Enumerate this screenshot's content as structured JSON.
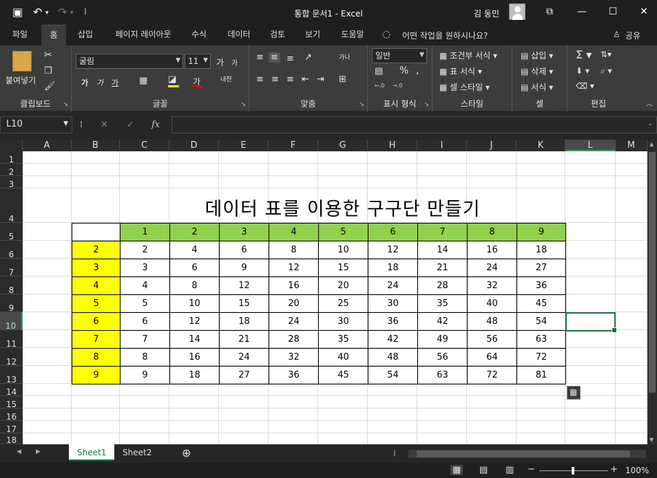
{
  "titlebar": {
    "title": "통합 문서1  -  Excel",
    "user": "김 동민",
    "save_icon": "save-icon",
    "undo_icon": "undo-icon",
    "redo_icon": "redo-icon"
  },
  "tabs": [
    "파일",
    "홈",
    "삽입",
    "페이지 레이아웃",
    "수식",
    "데이터",
    "검토",
    "보기",
    "도움말"
  ],
  "active_tab": "홈",
  "tell_me": "어떤 작업을 원하시나요?",
  "share": "공유",
  "ribbon": {
    "clipboard": {
      "paste": "붙여넣기",
      "label": "클립보드"
    },
    "font": {
      "name": "굴림",
      "size": "11",
      "label": "글꼴",
      "grow": "가",
      "shrink": "가",
      "bold": "가",
      "italic": "가",
      "underline": "가",
      "fill_color": "#ffff00",
      "font_color": "#ff0000",
      "phonetic": "내천"
    },
    "alignment": {
      "label": "맞춤",
      "wrap": "가나"
    },
    "number": {
      "format": "일반",
      "label": "표시 형식",
      "percent": "%",
      "comma": ",",
      "inc": ".00 ←.0",
      "dec": ".00 →.0"
    },
    "styles": {
      "conditional": "조건부 서식",
      "table": "표 서식",
      "cell_styles": "셀 스타일",
      "label": "스타일"
    },
    "cells": {
      "insert": "삽입",
      "delete": "삭제",
      "format": "서식",
      "label": "셀"
    },
    "editing": {
      "label": "편집"
    }
  },
  "formula_bar": {
    "name_box": "L10",
    "cancel": "✕",
    "enter": "✓",
    "fx": "fx",
    "value": ""
  },
  "columns": [
    "A",
    "B",
    "C",
    "D",
    "E",
    "F",
    "G",
    "H",
    "I",
    "J",
    "K",
    "L",
    "M"
  ],
  "rows": [
    "1",
    "2",
    "3",
    "4",
    "5",
    "6",
    "7",
    "8",
    "9",
    "10",
    "11",
    "12",
    "13",
    "14",
    "15",
    "16",
    "17",
    "18"
  ],
  "selected_column": "L",
  "selected_row": "10",
  "table": {
    "title": "데이터 표를 이용한 구구단 만들기",
    "header_row": [
      "1",
      "2",
      "3",
      "4",
      "5",
      "6",
      "7",
      "8",
      "9"
    ],
    "side_col": [
      "2",
      "3",
      "4",
      "5",
      "6",
      "7",
      "8",
      "9"
    ],
    "values": [
      [
        "2",
        "4",
        "6",
        "8",
        "10",
        "12",
        "14",
        "16",
        "18"
      ],
      [
        "3",
        "6",
        "9",
        "12",
        "15",
        "18",
        "21",
        "24",
        "27"
      ],
      [
        "4",
        "8",
        "12",
        "16",
        "20",
        "24",
        "28",
        "32",
        "36"
      ],
      [
        "5",
        "10",
        "15",
        "20",
        "25",
        "30",
        "35",
        "40",
        "45"
      ],
      [
        "6",
        "12",
        "18",
        "24",
        "30",
        "36",
        "42",
        "48",
        "54"
      ],
      [
        "7",
        "14",
        "21",
        "28",
        "35",
        "42",
        "49",
        "56",
        "63"
      ],
      [
        "8",
        "16",
        "24",
        "32",
        "40",
        "48",
        "56",
        "64",
        "72"
      ],
      [
        "9",
        "18",
        "27",
        "36",
        "45",
        "54",
        "63",
        "72",
        "81"
      ]
    ],
    "header_color": "#92d050",
    "side_color": "#ffff00"
  },
  "sheets": [
    "Sheet1",
    "Sheet2"
  ],
  "active_sheet": "Sheet1",
  "status": {
    "zoom": "100%"
  }
}
